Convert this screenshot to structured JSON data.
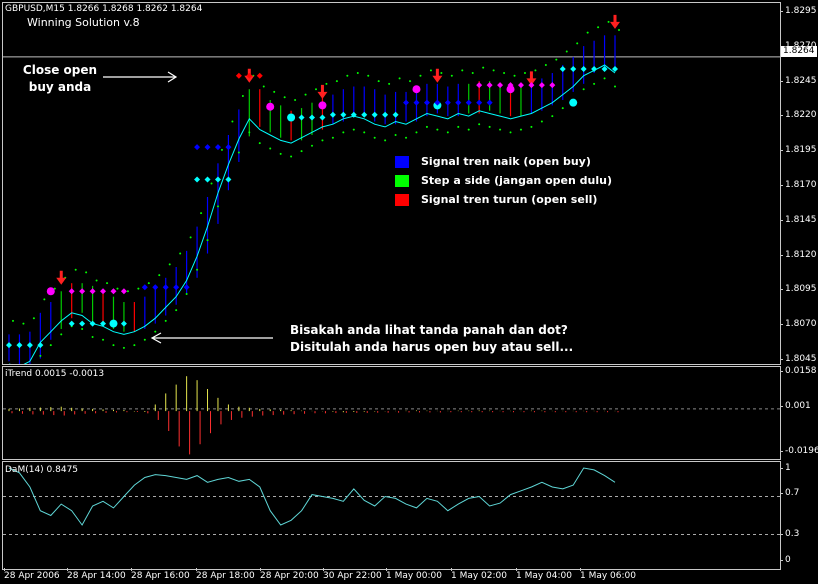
{
  "chart_header": {
    "symbol": "GBPUSD,M15",
    "ohlc": "1.8266 1.8268 1.8262 1.8264",
    "indicator_name": "Winning Solution v.8"
  },
  "price_axis": {
    "ticks": [
      "1.8295",
      "1.8270",
      "1.8245",
      "1.8220",
      "1.8195",
      "1.8170",
      "1.8145",
      "1.8120",
      "1.8095",
      "1.8070",
      "1.8045"
    ],
    "current_price": "1.8264"
  },
  "itrend": {
    "label": "iTrend 0.0015 -0.0013",
    "ticks": [
      "0.0158",
      "0.001",
      "-0.0196"
    ]
  },
  "dam": {
    "label": "DaM(14) 0.8475",
    "ticks": [
      "1",
      "0.7",
      "0.3",
      "0"
    ]
  },
  "time_axis": [
    "28 Apr 2006",
    "28 Apr 14:00",
    "28 Apr 16:00",
    "28 Apr 18:00",
    "28 Apr 20:00",
    "30 Apr 22:00",
    "1 May 00:00",
    "1 May 02:00",
    "1 May 04:00",
    "1 May 06:00"
  ],
  "annotations": {
    "close_line1": "Close open",
    "close_line2": "buy anda",
    "bottom_line1": "Bisakah anda lihat tanda panah dan dot?",
    "bottom_line2": "Disitulah anda harus open  buy atau sell..."
  },
  "legend": [
    {
      "label": "Signal tren naik (open buy)",
      "color": "#0000ff"
    },
    {
      "label": "Step a side (jangan open dulu)",
      "color": "#00ff00"
    },
    {
      "label": "Signal tren turun (open sell)",
      "color": "#ff0000"
    }
  ],
  "chart_data": {
    "type": "line",
    "price_series": [
      1.8048,
      1.8046,
      1.805,
      1.8064,
      1.8072,
      1.808,
      1.8086,
      1.8084,
      1.8078,
      1.8076,
      1.8072,
      1.807,
      1.8072,
      1.8076,
      1.8082,
      1.809,
      1.8098,
      1.811,
      1.8128,
      1.815,
      1.8175,
      1.8196,
      1.8215,
      1.823,
      1.8222,
      1.8218,
      1.8214,
      1.8212,
      1.8216,
      1.822,
      1.8224,
      1.8226,
      1.823,
      1.8232,
      1.823,
      1.8226,
      1.8224,
      1.8228,
      1.8226,
      1.823,
      1.8234,
      1.8232,
      1.823,
      1.8234,
      1.8232,
      1.8236,
      1.8234,
      1.8232,
      1.823,
      1.8232,
      1.8234,
      1.8238,
      1.8242,
      1.8248,
      1.8254,
      1.8262,
      1.8266,
      1.827,
      1.8264
    ],
    "itrend_values": [
      0.001,
      0.0012,
      0.0015,
      0.0016,
      0.0018,
      0.002,
      0.0015,
      0.0012,
      0.001,
      0.0008,
      0.0006,
      0.0005,
      -0.0002,
      -0.0004,
      0.003,
      0.008,
      0.012,
      0.0158,
      0.014,
      0.01,
      0.006,
      0.003,
      0.002,
      0.0015,
      0.001,
      0.0008,
      0.0006,
      0.0004,
      0.0002,
      0.0001,
      -0.0001,
      -0.0003,
      -0.0005,
      -0.0004,
      -0.0003,
      -0.0002,
      -0.0001,
      0.0001,
      0.0002,
      0.0003,
      0.0002,
      0.0001,
      0.0001,
      0.0002,
      0.0002,
      0.0003,
      0.0002,
      0.0001,
      0.0001,
      0.0001,
      0.0002,
      0.0002,
      0.0001,
      0.0001,
      0.0001,
      0.0001,
      0.0001,
      0.0001,
      0.0001
    ],
    "itrend_neg": [
      -0.001,
      -0.0012,
      -0.0015,
      -0.0016,
      -0.0018,
      -0.002,
      -0.0015,
      -0.0012,
      -0.001,
      -0.0008,
      -0.0006,
      -0.0005,
      -0.0004,
      -0.001,
      -0.004,
      -0.009,
      -0.016,
      -0.0196,
      -0.015,
      -0.01,
      -0.006,
      -0.004,
      -0.003,
      -0.0025,
      -0.002,
      -0.0018,
      -0.0016,
      -0.0014,
      -0.0012,
      -0.001,
      -0.001,
      -0.0009,
      -0.0008,
      -0.0008,
      -0.0008,
      -0.0007,
      -0.0007,
      -0.0007,
      -0.0006,
      -0.0006,
      -0.0006,
      -0.0006,
      -0.0005,
      -0.0005,
      -0.0005,
      -0.0005,
      -0.0005,
      -0.0005,
      -0.0005,
      -0.0005,
      -0.0005,
      -0.0005,
      -0.0005,
      -0.0005,
      -0.0005,
      -0.0005,
      -0.0005,
      -0.0005,
      -0.0005
    ],
    "dam_values": [
      1.0,
      0.95,
      0.8,
      0.55,
      0.5,
      0.62,
      0.55,
      0.4,
      0.6,
      0.65,
      0.58,
      0.7,
      0.82,
      0.9,
      0.93,
      0.92,
      0.9,
      0.88,
      0.92,
      0.85,
      0.88,
      0.9,
      0.86,
      0.88,
      0.8,
      0.55,
      0.4,
      0.45,
      0.55,
      0.72,
      0.7,
      0.68,
      0.65,
      0.78,
      0.66,
      0.6,
      0.7,
      0.68,
      0.62,
      0.58,
      0.68,
      0.65,
      0.55,
      0.62,
      0.68,
      0.7,
      0.6,
      0.63,
      0.72,
      0.76,
      0.8,
      0.85,
      0.8,
      0.78,
      0.82,
      1.0,
      0.98,
      0.92,
      0.85
    ],
    "itrend_ylim": [
      -0.0196,
      0.0158
    ],
    "dam_ylim": [
      0,
      1
    ],
    "price_ylim": [
      1.8036,
      1.8304
    ]
  }
}
